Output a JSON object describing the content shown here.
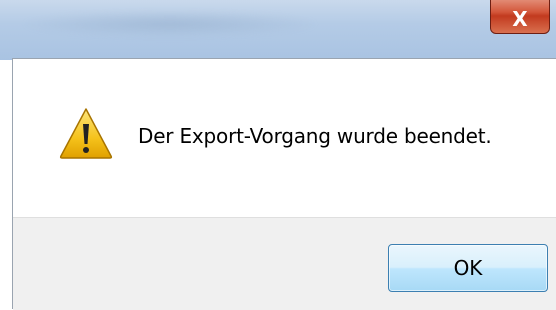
{
  "titlebar": {
    "close_label": "X"
  },
  "dialog": {
    "icon": "warning-icon",
    "message": "Der Export-Vorgang wurde beendet.",
    "ok_label": "OK"
  },
  "colors": {
    "titlebar": "#b4cbe6",
    "close_button": "#c23a1f",
    "footer": "#f0f0f0",
    "button_border": "#3c7fb1",
    "warning_fill": "#f5c21b"
  }
}
